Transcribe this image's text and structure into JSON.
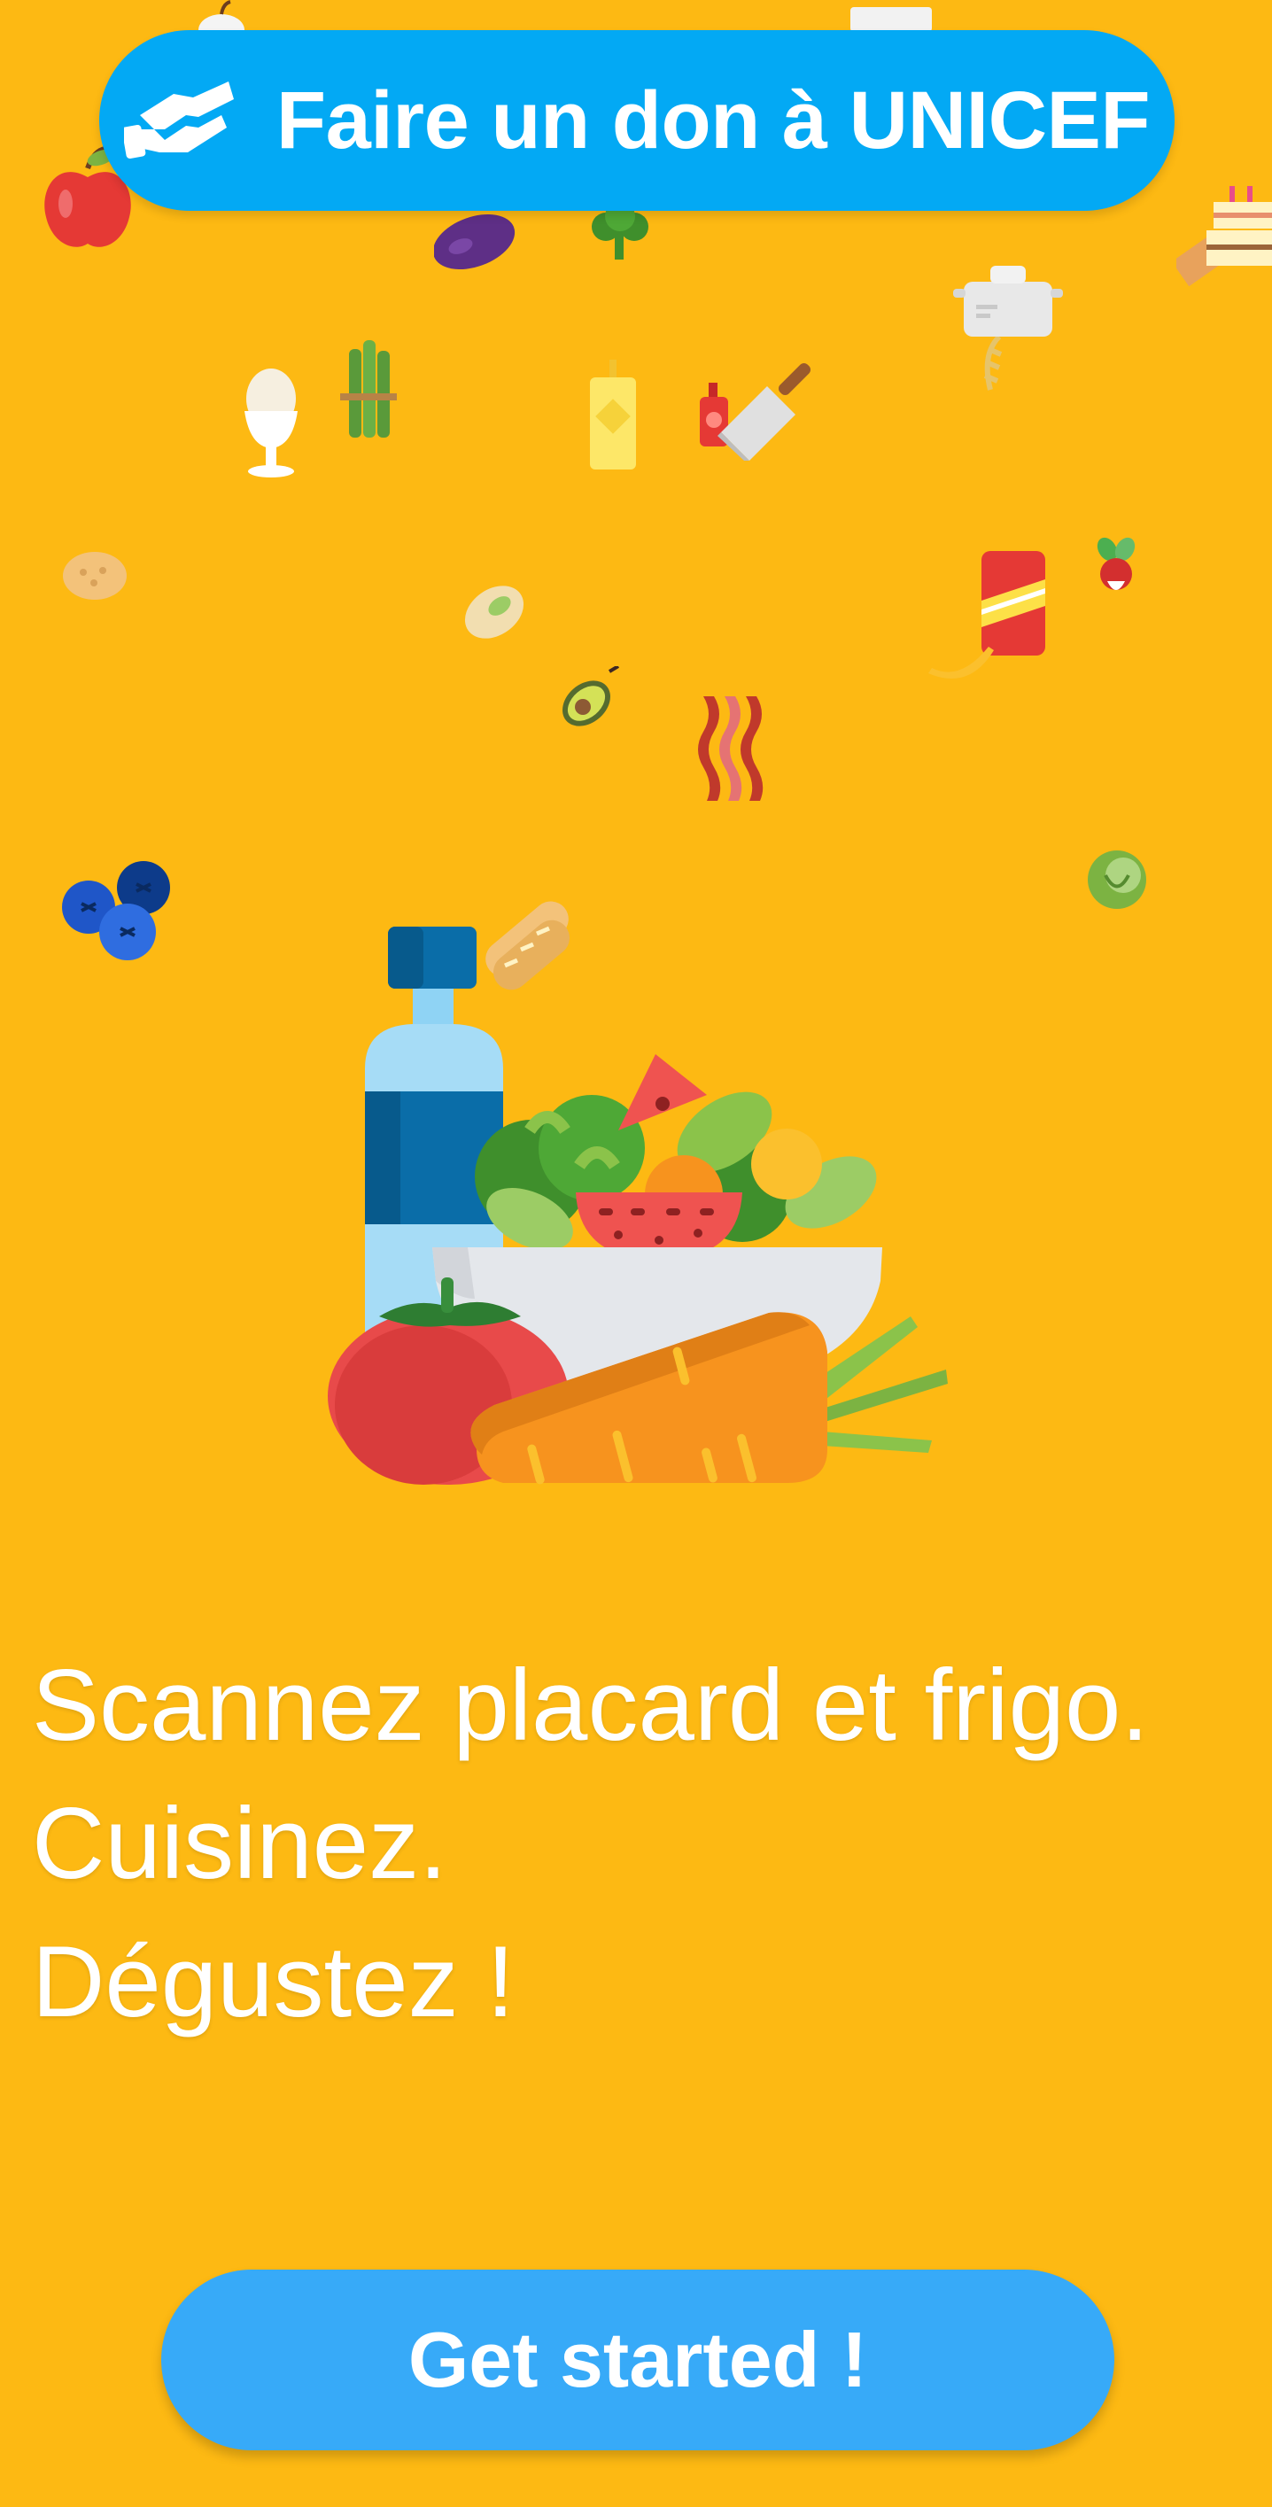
{
  "donate_button": {
    "label": "Faire un don à UNICEF",
    "icon": "hand-gift-icon"
  },
  "tagline": {
    "line1": "Scannez placard et frigo.",
    "line2": "Cuisinez.",
    "line3": "Dégustez !"
  },
  "cta_button": {
    "label": "Get started !"
  },
  "decorations": [
    "apple-icon",
    "eggplant-icon",
    "broccoli-icon",
    "cooking-pot-icon",
    "cake-icon",
    "egg-icon",
    "asparagus-icon",
    "mustard-icon",
    "ketchup-icon",
    "cleaver-icon",
    "pie-icon",
    "pistachio-icon",
    "soda-can-icon",
    "radish-icon",
    "banana-icon",
    "avocado-icon",
    "bacon-icon",
    "blueberries-icon",
    "lettuce-icon",
    "baguette-icon",
    "food-bowl-illustration"
  ],
  "colors": {
    "background": "#FDB913",
    "donate_button": "#03A9F4",
    "cta_button": "#37AAF8",
    "text": "#FFFFFF"
  }
}
